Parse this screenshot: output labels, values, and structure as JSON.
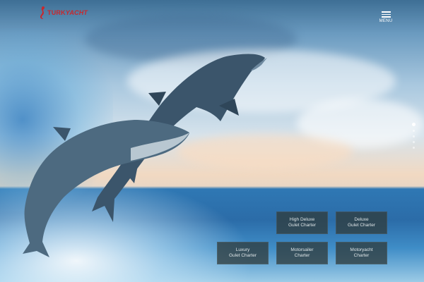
{
  "logo": {
    "brand_a": "TURK",
    "brand_b": "YACHT"
  },
  "menu": {
    "label": "MENU",
    "icon": "hamburger-icon"
  },
  "slider": {
    "slides": 5,
    "active": 1
  },
  "tiles": [
    {
      "line1": "High Deluxe",
      "line2": "Gulet Charter"
    },
    {
      "line1": "Deluxe",
      "line2": "Gulet Charter"
    },
    {
      "line1": "Luxury",
      "line2": "Gulet Charter"
    },
    {
      "line1": "Motorsailer",
      "line2": "Charter"
    },
    {
      "line1": "Motoryacht",
      "line2": "Charter"
    }
  ],
  "colors": {
    "brand_red": "#c8282d",
    "tile_bg": "#303c3e",
    "sea": "#2b6ca8"
  }
}
